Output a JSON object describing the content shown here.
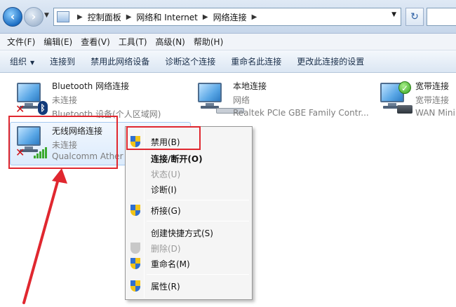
{
  "addressbar": {
    "crumbs": [
      "控制面板",
      "网络和 Internet",
      "网络连接"
    ],
    "refresh_glyph": "↻"
  },
  "menubar": [
    "文件(F)",
    "编辑(E)",
    "查看(V)",
    "工具(T)",
    "高级(N)",
    "帮助(H)"
  ],
  "commandbar": {
    "organize": "组织",
    "commands": [
      "连接到",
      "禁用此网络设备",
      "诊断这个连接",
      "重命名此连接",
      "更改此连接的设置"
    ]
  },
  "connections": [
    {
      "name": "Bluetooth 网络连接",
      "status": "未连接",
      "device": "Bluetooth 设备(个人区域网)",
      "badge": "bluetooth",
      "error": true
    },
    {
      "name": "本地连接",
      "status": "网络",
      "device": "Realtek PCIe GBE Family Contr...",
      "badge": "ethernet",
      "error": false
    },
    {
      "name": "宽带连接",
      "status": "宽带连接",
      "device": "WAN Mini",
      "badge": "connected",
      "error": false
    },
    {
      "name": "无线网络连接",
      "status": "未连接",
      "device": "Qualcomm Athero",
      "badge": "wifi",
      "error": true,
      "selected": true
    }
  ],
  "context_menu": [
    {
      "label": "禁用(B)",
      "shield": true,
      "bold": false,
      "disabled": false
    },
    {
      "label": "连接/断开(O)",
      "shield": false,
      "bold": true,
      "disabled": false
    },
    {
      "label": "状态(U)",
      "shield": false,
      "bold": false,
      "disabled": true
    },
    {
      "label": "诊断(I)",
      "shield": false,
      "bold": false,
      "disabled": false
    },
    {
      "label": "桥接(G)",
      "shield": true,
      "bold": false,
      "disabled": false
    },
    {
      "label": "创建快捷方式(S)",
      "shield": false,
      "bold": false,
      "disabled": false
    },
    {
      "label": "删除(D)",
      "shield": true,
      "bold": false,
      "disabled": true
    },
    {
      "label": "重命名(M)",
      "shield": true,
      "bold": false,
      "disabled": false
    },
    {
      "label": "属性(R)",
      "shield": true,
      "bold": false,
      "disabled": false
    }
  ],
  "colors": {
    "annotation": "#e0272f",
    "accent": "#2f6fd1"
  }
}
